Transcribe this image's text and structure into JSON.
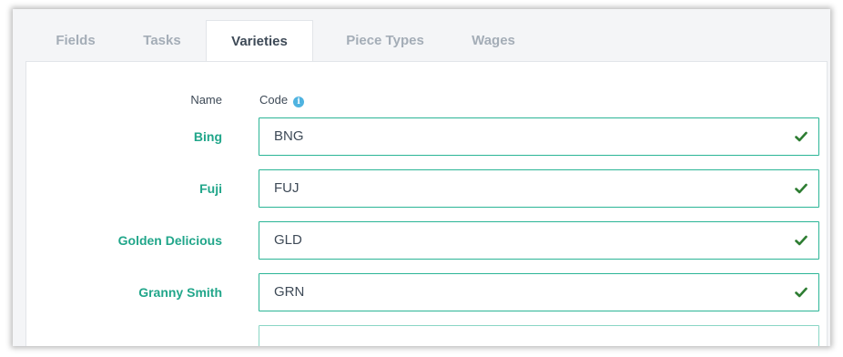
{
  "tabs": [
    {
      "label": "Fields",
      "active": false
    },
    {
      "label": "Tasks",
      "active": false
    },
    {
      "label": "Varieties",
      "active": true
    },
    {
      "label": "Piece Types",
      "active": false
    },
    {
      "label": "Wages",
      "active": false
    }
  ],
  "table": {
    "name_header": "Name",
    "code_header": "Code",
    "info_icon": "info-icon"
  },
  "varieties": [
    {
      "name": "Bing",
      "code": "BNG",
      "status_icon": "check-icon"
    },
    {
      "name": "Fuji",
      "code": "FUJ",
      "status_icon": "check-icon"
    },
    {
      "name": "Golden Delicious",
      "code": "GLD",
      "status_icon": "check-icon"
    },
    {
      "name": "Granny Smith",
      "code": "GRN",
      "status_icon": "check-icon"
    }
  ],
  "colors": {
    "accent": "#21a68a",
    "input_border": "#2bb596",
    "check": "#2e7d32",
    "info": "#4fb3e0",
    "tab_inactive": "#a4adb7",
    "text": "#3e4a57"
  }
}
